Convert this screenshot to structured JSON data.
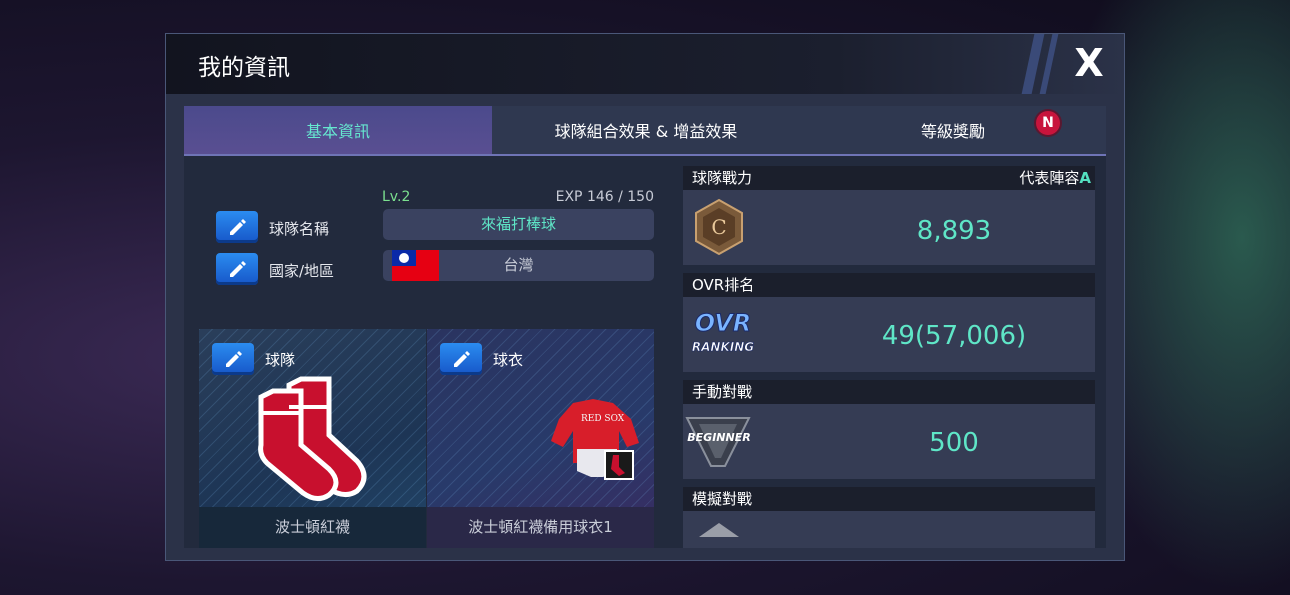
{
  "window": {
    "title": "我的資訊",
    "close_label": "X"
  },
  "tabs": [
    {
      "label": "基本資訊",
      "active": true
    },
    {
      "label": "球隊組合效果 & 增益效果",
      "active": false
    },
    {
      "label": "等級獎勵",
      "active": false,
      "badge": "N"
    }
  ],
  "profile": {
    "level": "Lv.2",
    "exp": "EXP 146 / 150",
    "team_name_label": "球隊名稱",
    "team_name_value": "來福打棒球",
    "country_label": "國家/地區",
    "country_value": "台灣"
  },
  "cards": {
    "team": {
      "label": "球隊",
      "name": "波士頓紅襪"
    },
    "uniform": {
      "label": "球衣",
      "name": "波士頓紅襪備用球衣1"
    }
  },
  "stats": {
    "team_power": {
      "title": "球隊戰力",
      "lineup_label": "代表陣容",
      "lineup_value": "A",
      "rank_badge": "C",
      "value": "8,893"
    },
    "ovr_ranking": {
      "title": "OVR排名",
      "badge_line1": "OVR",
      "badge_line2": "RANKING",
      "value": "49(57,006)"
    },
    "manual_battle": {
      "title": "手動對戰",
      "badge": "BEGINNER",
      "value": "500"
    },
    "sim_battle": {
      "title": "模擬對戰"
    }
  },
  "colors": {
    "accent": "#5fe6c7",
    "active_tab": "#4b4a8c",
    "edit_button": "#1e6ee0",
    "badge": "#c8143c"
  }
}
